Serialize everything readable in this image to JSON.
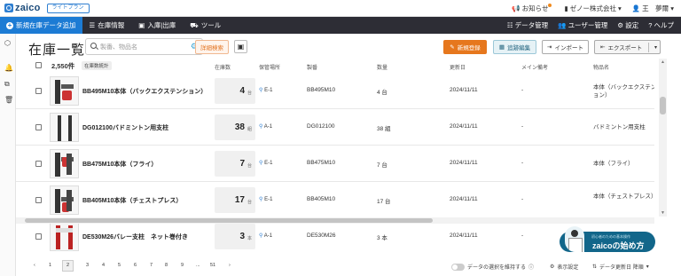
{
  "app": {
    "logo": "zaico",
    "plan": "ライトプラン"
  },
  "topbar": {
    "notifications": "お知らせ",
    "company": "ゼノー株式会社 ▾",
    "user": "王　夢爾 ▾"
  },
  "nav": {
    "new_item": "新規在庫データ追加",
    "items": [
      "在庫情報",
      "入庫|出庫",
      "ツール"
    ],
    "right": [
      "データ管理",
      "ユーザー管理",
      "設定",
      "ヘルプ"
    ]
  },
  "page": {
    "title": "在庫一覧",
    "search_placeholder": "製番、物品名",
    "advanced_search": "詳細検索",
    "scan_icon": "qr-scan-icon"
  },
  "toolbar": {
    "register": "新規登録",
    "tracking": "追跡編集",
    "import": "インポート",
    "export": "エクスポート"
  },
  "table": {
    "count": "2,550件",
    "count_tag": "在庫数統計",
    "headers": [
      "在庫数",
      "保管場所",
      "製番",
      "数量",
      "更新日",
      "メイン備考",
      "物品名"
    ],
    "rows": [
      {
        "name": "BB495M10本体（バックエクステンション）",
        "stock": "4",
        "unit": "台",
        "location": "E-1",
        "code": "BB495M10",
        "qty": "4 台",
        "date": "2024/11/11",
        "memo": "-",
        "product": "本体（バックエクステンション）"
      },
      {
        "name": "DG012100バドミントン用支柱",
        "stock": "38",
        "unit": "組",
        "location": "A-1",
        "code": "DG012100",
        "qty": "38 組",
        "date": "2024/11/11",
        "memo": "-",
        "product": "バドミントン用支柱"
      },
      {
        "name": "BB475M10本体（フライ）",
        "stock": "7",
        "unit": "台",
        "location": "E-1",
        "code": "BB475M10",
        "qty": "7 台",
        "date": "2024/11/11",
        "memo": "-",
        "product": "本体（フライ）"
      },
      {
        "name": "BB405M10本体（チェストプレス）",
        "stock": "17",
        "unit": "台",
        "location": "E-1",
        "code": "BB405M10",
        "qty": "17 台",
        "date": "2024/11/11",
        "memo": "-",
        "product": "本体（チェストプレス）"
      },
      {
        "name": "DE530M26バレー支柱　ネット巻付き",
        "stock": "3",
        "unit": "本",
        "location": "A-1",
        "code": "DE530M26",
        "qty": "3 本",
        "date": "2024/11/11",
        "memo": "-",
        "product": ""
      }
    ]
  },
  "pagination": {
    "prev": "‹",
    "pages": [
      "1",
      "2",
      "3",
      "4",
      "5",
      "6",
      "7",
      "8",
      "9",
      "...",
      "51"
    ],
    "next": "›"
  },
  "footer": {
    "keep_selection": "データの選択を維持する",
    "display_settings": "表示設定",
    "sort_label": "データ更新日 降順"
  },
  "banner": {
    "small_text": "初心者のための基本操作",
    "big_text": "zaicoの始め方"
  },
  "colors": {
    "accent": "#1c7bd4",
    "nav_bg": "#2d2d35",
    "register_btn": "#e6771d",
    "banner": "#12668a"
  }
}
